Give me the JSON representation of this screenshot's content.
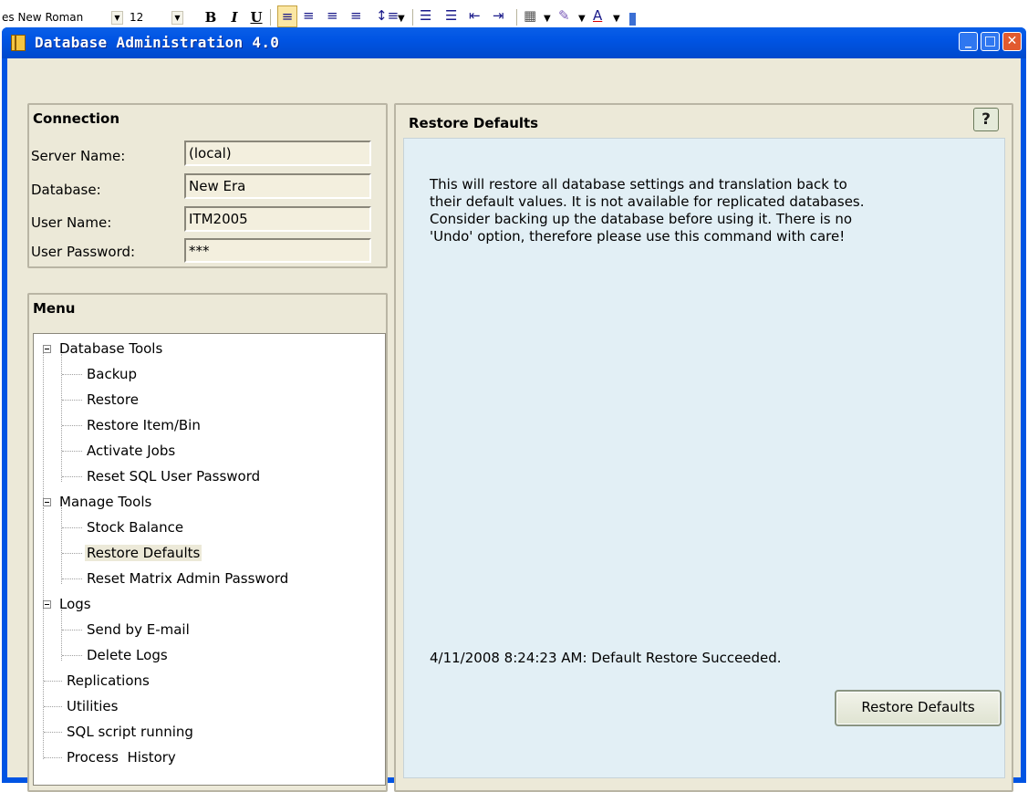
{
  "toolbar": {
    "font_name": "es New Roman",
    "font_size": "12",
    "bold": "B",
    "italic": "I",
    "underline": "U"
  },
  "window": {
    "title": "Database Administration 4.0",
    "minimize_glyph": "_",
    "maximize_glyph": "□",
    "close_glyph": "✕"
  },
  "connection": {
    "title": "Connection",
    "fields": [
      {
        "label": "Server Name:",
        "value": "(local)"
      },
      {
        "label": "Database:",
        "value": "New Era"
      },
      {
        "label": "User Name:",
        "value": "ITM2005"
      },
      {
        "label": "User Password:",
        "value": "***"
      }
    ]
  },
  "menu": {
    "title": "Menu",
    "items": [
      {
        "label": "Database Tools"
      },
      {
        "label": "Backup"
      },
      {
        "label": "Restore"
      },
      {
        "label": "Restore Item/Bin"
      },
      {
        "label": "Activate Jobs"
      },
      {
        "label": "Reset SQL User Password"
      },
      {
        "label": "Manage Tools"
      },
      {
        "label": "Stock Balance"
      },
      {
        "label": "Restore Defaults",
        "selected": true
      },
      {
        "label": "Reset Matrix Admin Password"
      },
      {
        "label": "Logs"
      },
      {
        "label": "Send by E-mail"
      },
      {
        "label": "Delete Logs"
      },
      {
        "label": "Replications"
      },
      {
        "label": "Utilities"
      },
      {
        "label": "SQL script running"
      },
      {
        "label": "Process  History"
      }
    ]
  },
  "detail": {
    "title": "Restore Defaults",
    "help_glyph": "?",
    "description_lines": [
      "This will restore all database settings and translation back to",
      "their default values. It is not available for replicated databases.",
      "Consider backing up the database before using it. There is no",
      "'Undo' option, therefore please use this command with care!"
    ],
    "status": "4/11/2008 8:24:23 AM: Default Restore Succeeded.",
    "button_label": "Restore Defaults"
  }
}
